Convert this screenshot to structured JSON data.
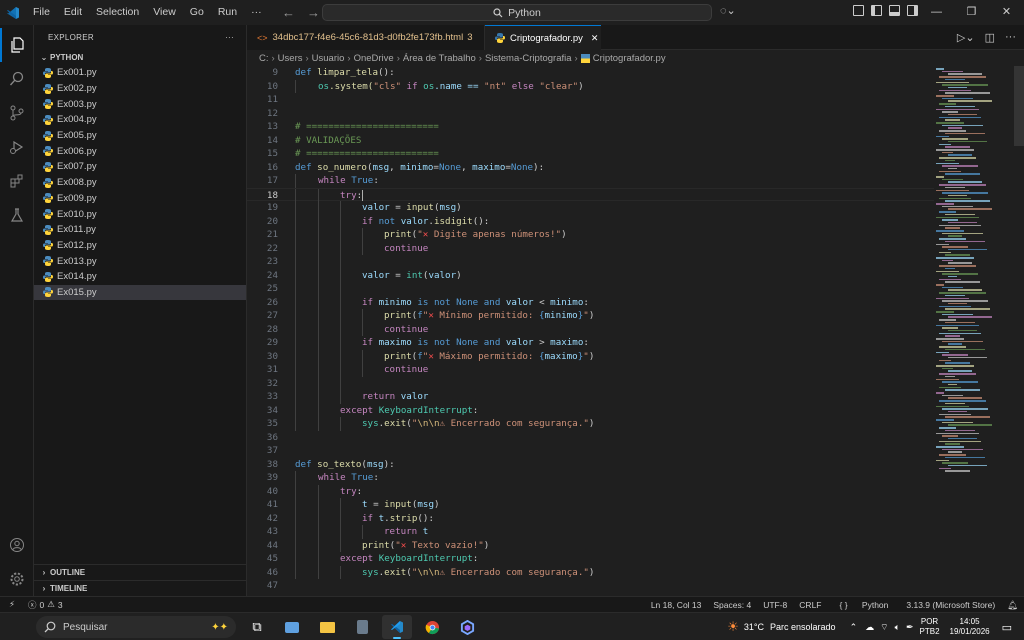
{
  "menu": [
    "File",
    "Edit",
    "Selection",
    "View",
    "Go",
    "Run",
    "···"
  ],
  "search": {
    "label": "Python"
  },
  "window_controls": {
    "minimize": "—",
    "restore": "❐",
    "close": "✕"
  },
  "sidebar": {
    "title": "EXPLORER",
    "more": "···",
    "folder": "PYTHON",
    "files": [
      "Ex001.py",
      "Ex002.py",
      "Ex003.py",
      "Ex004.py",
      "Ex005.py",
      "Ex006.py",
      "Ex007.py",
      "Ex008.py",
      "Ex009.py",
      "Ex010.py",
      "Ex011.py",
      "Ex012.py",
      "Ex013.py",
      "Ex014.py",
      "Ex015.py"
    ],
    "active_file_index": 14,
    "outline": "OUTLINE",
    "timeline": "TIMELINE"
  },
  "tabs": [
    {
      "label": "34dbc177-f4e6-45c6-81d3-d0fb2fe173fb.html",
      "badge": "3"
    },
    {
      "label": "Criptografador.py",
      "close": "✕"
    }
  ],
  "breadcrumb": [
    "C:",
    "Users",
    "Usuario",
    "OneDrive",
    "Área de Trabalho",
    "Sistema-Criptografia",
    "Criptografador.py"
  ],
  "editor": {
    "current_line": 18,
    "line_numbers": [
      "9",
      "10",
      "11",
      "12",
      "13",
      "14",
      "15",
      "16",
      "17",
      "18",
      "19",
      "20",
      "21",
      "22",
      "23",
      "24",
      "25",
      "26",
      "27",
      "28",
      "29",
      "30",
      "31",
      "32",
      "33",
      "34",
      "35",
      "36",
      "37",
      "38",
      "39",
      "40",
      "41",
      "42",
      "43",
      "44",
      "45",
      "46",
      "47"
    ],
    "code": {
      "l9_def": "def",
      "l9_name": "limpar_tela",
      "l9_rest": "():",
      "l10_os": "os",
      "l10_sys": ".system(",
      "l10_s1": "\"cls\"",
      "l10_if": " if ",
      "l10_os2": "os",
      "l10_name": ".name == ",
      "l10_s2": "\"nt\"",
      "l10_else": " else ",
      "l10_s3": "\"clear\"",
      "l10_end": ")",
      "l13": "# ========================",
      "l14": "# VALIDAÇÕES",
      "l15": "# ========================",
      "l16_def": "def",
      "l16_name": "so_numero",
      "l16_a": "(",
      "l16_p1": "msg",
      "l16_b": ", ",
      "l16_p2": "minimo",
      "l16_c": "=",
      "l16_n1": "None",
      "l16_d": ", ",
      "l16_p3": "maximo",
      "l16_e": "=",
      "l16_n2": "None",
      "l16_f": "):",
      "l17_while": "while",
      "l17_true": " True",
      "l17_end": ":",
      "l18_try": "try",
      "l18_end": ":",
      "l19_v": "valor",
      "l19_eq": " = ",
      "l19_fn": "input",
      "l19_a": "(",
      "l19_m": "msg",
      "l19_b": ")",
      "l20_if": "if",
      "l20_not": " not ",
      "l20_v": "valor",
      "l20_dot": ".",
      "l20_fn": "isdigit",
      "l20_end": "():",
      "l21_fn": "print",
      "l21_a": "(",
      "l21_s1": "\"",
      "l21_x": "✕",
      "l21_s2": " Digite apenas números!\"",
      "l21_b": ")",
      "l22": "continue",
      "l24_v": "valor",
      "l24_eq": " = ",
      "l24_fn": "int",
      "l24_a": "(",
      "l24_v2": "valor",
      "l24_b": ")",
      "l26_if": "if",
      "l26_m": " minimo",
      "l26_is": " is not ",
      "l26_none": "None",
      "l26_and": " and ",
      "l26_v": "valor",
      "l26_lt": " < ",
      "l26_m2": "minimo",
      "l26_end": ":",
      "l27_fn": "print",
      "l27_a": "(",
      "l27_f": "f",
      "l27_s1": "\"",
      "l27_x": "✕",
      "l27_s2": " Mínimo permitido: ",
      "l27_br1": "{",
      "l27_var": "minimo",
      "l27_br2": "}",
      "l27_s3": "\"",
      "l27_b": ")",
      "l28": "continue",
      "l29_if": "if",
      "l29_m": " maximo",
      "l29_is": " is not ",
      "l29_none": "None",
      "l29_and": " and ",
      "l29_v": "valor",
      "l29_gt": " > ",
      "l29_m2": "maximo",
      "l29_end": ":",
      "l30_fn": "print",
      "l30_a": "(",
      "l30_f": "f",
      "l30_s1": "\"",
      "l30_x": "✕",
      "l30_s2": " Máximo permitido: ",
      "l30_br1": "{",
      "l30_var": "maximo",
      "l30_br2": "}",
      "l30_s3": "\"",
      "l30_b": ")",
      "l31": "continue",
      "l33_ret": "return",
      "l33_v": " valor",
      "l34_exc": "except",
      "l34_cls": " KeyboardInterrupt",
      "l34_end": ":",
      "l35_sys": "sys",
      "l35_dot": ".",
      "l35_fn": "exit",
      "l35_a": "(",
      "l35_q": "\"",
      "l35_esc": "\\n\\n",
      "l35_s": "⚠ Encerrado com segurança.\"",
      "l35_b": ")",
      "l38_def": "def",
      "l38_name": "so_texto",
      "l38_a": "(",
      "l38_p": "msg",
      "l38_b": "):",
      "l39_while": "while",
      "l39_true": " True",
      "l39_end": ":",
      "l40_try": "try",
      "l40_end": ":",
      "l41_t": "t",
      "l41_eq": " = ",
      "l41_fn": "input",
      "l41_a": "(",
      "l41_m": "msg",
      "l41_b": ")",
      "l42_if": "if",
      "l42_t": " t",
      "l42_dot": ".",
      "l42_fn": "strip",
      "l42_end": "():",
      "l43_ret": "return",
      "l43_t": " t",
      "l44_fn": "print",
      "l44_a": "(",
      "l44_s1": "\"",
      "l44_x": "✕",
      "l44_s2": " Texto vazio!\"",
      "l44_b": ")",
      "l45_exc": "except",
      "l45_cls": " KeyboardInterrupt",
      "l45_end": ":",
      "l46_sys": "sys",
      "l46_dot": ".",
      "l46_fn": "exit",
      "l46_a": "(",
      "l46_q": "\"",
      "l46_esc": "\\n\\n",
      "l46_s": "⚠ Encerrado com segurança.\"",
      "l46_b": ")"
    }
  },
  "statusbar": {
    "errors": "0",
    "warnings": "3",
    "position": "Ln 18, Col 13",
    "spaces": "Spaces: 4",
    "encoding": "UTF-8",
    "eol": "CRLF",
    "braces": "{ }",
    "language": "Python",
    "interpreter": "3.13.9 (Microsoft Store)"
  },
  "taskbar": {
    "search_placeholder": "Pesquisar",
    "weather_temp": "31°C",
    "weather_desc": "Parc ensolarado",
    "lang_top": "POR",
    "lang_bottom": "PTB2",
    "time": "14:05",
    "date": "19/01/2026"
  },
  "colors": {
    "accent": "#0078d4",
    "editor_bg": "#1f1f1f",
    "sidebar_bg": "#181818",
    "modified_tab": "#e2c08d"
  }
}
